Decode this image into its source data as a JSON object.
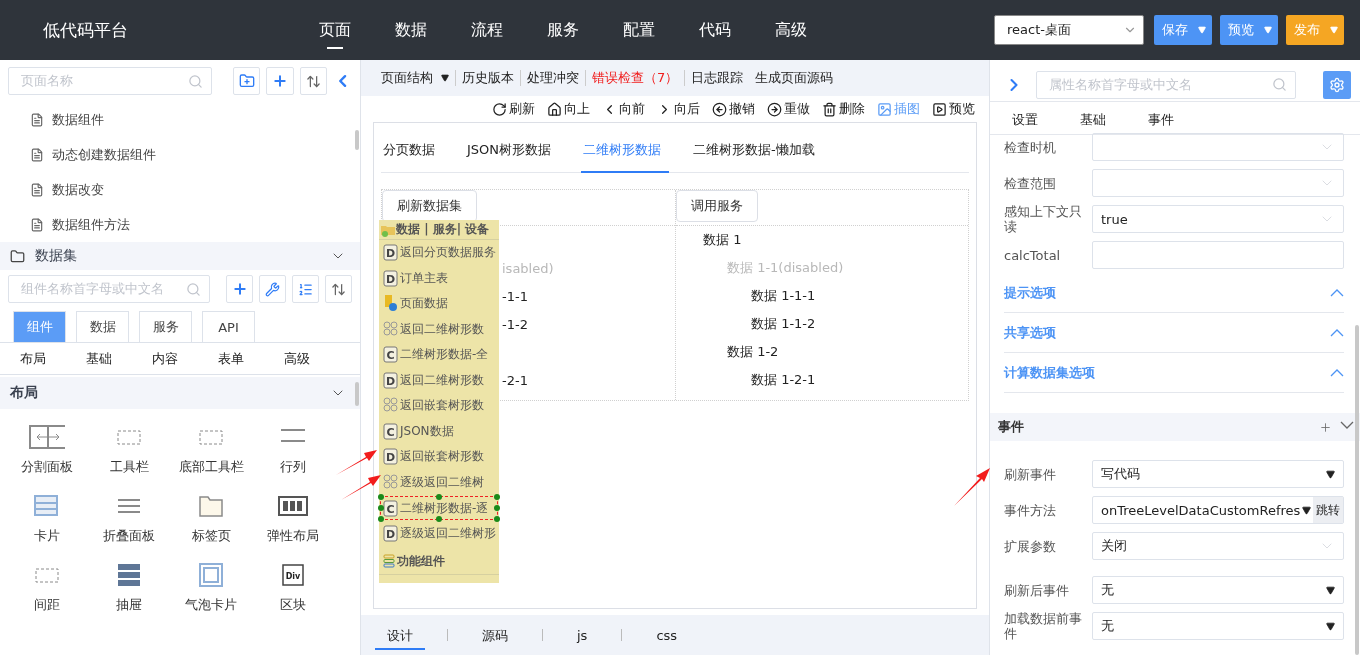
{
  "header": {
    "logo": "低代码平台",
    "nav": [
      {
        "label": "页面",
        "selected": true
      },
      {
        "label": "数据",
        "selected": false
      },
      {
        "label": "流程",
        "selected": false
      },
      {
        "label": "服务",
        "selected": false
      },
      {
        "label": "配置",
        "selected": false
      },
      {
        "label": "代码",
        "selected": false
      },
      {
        "label": "高级",
        "selected": false
      }
    ],
    "app_select": "react-桌面",
    "buttons": [
      {
        "label": "保存",
        "kind": "primary"
      },
      {
        "label": "预览",
        "kind": "primary"
      },
      {
        "label": "发布",
        "kind": "accent"
      }
    ]
  },
  "left_panel": {
    "page_search": {
      "placeholder": "页面名称"
    },
    "pages": [
      "数据组件",
      "动态创建数据组件",
      "数据改变",
      "数据组件方法"
    ],
    "dataset_section": "数据集",
    "component_search": {
      "placeholder": "组件名称首字母或中文名"
    },
    "tabs": [
      {
        "label": "组件",
        "selected": true
      },
      {
        "label": "数据",
        "selected": false
      },
      {
        "label": "服务",
        "selected": false
      },
      {
        "label": "API",
        "selected": false
      }
    ],
    "categories": [
      "布局",
      "基础",
      "内容",
      "表单",
      "高级"
    ],
    "layout_section": "布局",
    "components": [
      {
        "label": "分割面板"
      },
      {
        "label": "工具栏"
      },
      {
        "label": "底部工具栏"
      },
      {
        "label": "行列"
      },
      {
        "label": "卡片"
      },
      {
        "label": "折叠面板"
      },
      {
        "label": "标签页"
      },
      {
        "label": "弹性布局"
      },
      {
        "label": "间距"
      },
      {
        "label": "抽屉"
      },
      {
        "label": "气泡卡片"
      },
      {
        "label": "区块",
        "icon_text": "Div"
      }
    ]
  },
  "toolbar": {
    "menu": [
      {
        "label": "页面结构",
        "kind": "dropdown",
        "divider": true
      },
      {
        "label": "历史版本",
        "kind": "plain",
        "divider": true
      },
      {
        "label": "处理冲突",
        "kind": "plain",
        "divider": true
      },
      {
        "label": "错误检查（7）",
        "kind": "error",
        "divider": true
      },
      {
        "label": "日志跟踪",
        "kind": "plain",
        "divider": false
      },
      {
        "label": "生成页面源码",
        "kind": "plain",
        "divider": false
      }
    ],
    "actions": [
      {
        "label": "刷新",
        "highlighted": false
      },
      {
        "label": "向上",
        "highlighted": false
      },
      {
        "label": "向前",
        "highlighted": false
      },
      {
        "label": "向后",
        "highlighted": false
      },
      {
        "label": "撤销",
        "highlighted": false
      },
      {
        "label": "重做",
        "highlighted": false
      },
      {
        "label": "删除",
        "highlighted": false
      },
      {
        "label": "插图",
        "highlighted": true
      },
      {
        "label": "预览",
        "highlighted": false
      }
    ]
  },
  "canvas": {
    "tabs": [
      {
        "label": "分页数据",
        "selected": false
      },
      {
        "label": "JSON树形数据",
        "selected": false
      },
      {
        "label": "二维树形数据",
        "selected": true
      },
      {
        "label": "二维树形数据-懒加载",
        "selected": false
      }
    ],
    "buttons": [
      "刷新数据集",
      "调用服务"
    ],
    "left_tree": [
      {
        "kind": "covered"
      },
      {
        "kind": "text",
        "text": "isabled)",
        "disabled": true
      },
      {
        "kind": "text",
        "text": "-1-1",
        "disabled": false
      },
      {
        "kind": "text",
        "text": "-1-2",
        "disabled": false
      },
      {
        "kind": "covered"
      },
      {
        "kind": "text",
        "text": "-2-1",
        "disabled": false
      }
    ],
    "right_tree": [
      {
        "text": "数据 1",
        "disabled": false,
        "children": [
          {
            "text": "数据 1-1(disabled)",
            "disabled": true,
            "children": [
              {
                "text": "数据 1-1-1",
                "disabled": false
              },
              {
                "text": "数据 1-1-2",
                "disabled": false
              }
            ]
          },
          {
            "text": "数据 1-2",
            "disabled": false,
            "children": [
              {
                "text": "数据 1-2-1",
                "disabled": false
              }
            ]
          }
        ]
      }
    ]
  },
  "popup": {
    "title": "数据 | 服务| 设备",
    "items": [
      {
        "kind": "letter",
        "letter": "D",
        "text": "返回分页数据服务",
        "selected": false
      },
      {
        "kind": "letter",
        "letter": "D",
        "text": "订单主表",
        "selected": false
      },
      {
        "kind": "page",
        "text": "页面数据",
        "selected": false
      },
      {
        "kind": "clover",
        "text": "返回二维树形数",
        "selected": false
      },
      {
        "kind": "letter",
        "letter": "C",
        "text": "二维树形数据-全",
        "selected": false
      },
      {
        "kind": "letter",
        "letter": "D",
        "text": "返回二维树形数",
        "selected": false
      },
      {
        "kind": "clover",
        "text": "返回嵌套树形数",
        "selected": false
      },
      {
        "kind": "letter",
        "letter": "C",
        "text": "JSON数据",
        "selected": false
      },
      {
        "kind": "letter",
        "letter": "D",
        "text": "返回嵌套树形数",
        "selected": false
      },
      {
        "kind": "clover",
        "text": "逐级返回二维树",
        "selected": false
      },
      {
        "kind": "letter",
        "letter": "C",
        "text": "二维树形数据-逐",
        "selected": true
      },
      {
        "kind": "letter",
        "letter": "D",
        "text": "逐级返回二维树形",
        "selected": false
      }
    ],
    "footer": "功能组件"
  },
  "bottom_tabs": [
    {
      "label": "设计",
      "selected": true
    },
    {
      "label": "源码",
      "selected": false
    },
    {
      "label": "js",
      "selected": false
    },
    {
      "label": "css",
      "selected": false
    }
  ],
  "right_panel": {
    "search": {
      "placeholder": "属性名称首字母或中文名"
    },
    "tabs": [
      "设置",
      "基础",
      "事件"
    ],
    "fields": [
      {
        "label": "检查时机",
        "kind": "select"
      },
      {
        "label": "检查范围",
        "kind": "select"
      },
      {
        "label": "感知上下文只读",
        "kind": "select",
        "value": "true"
      },
      {
        "label": "calcTotal",
        "kind": "input"
      }
    ],
    "sections": [
      "提示选项",
      "共享选项",
      "计算数据集选项"
    ],
    "events_title": "事件",
    "event_fields": [
      {
        "label": "刷新事件",
        "kind": "dropdown",
        "value": "写代码"
      },
      {
        "label": "事件方法",
        "kind": "jump",
        "value": "onTreeLevelDataCustomRefres",
        "button": "跳转"
      },
      {
        "label": "扩展参数",
        "kind": "select",
        "value": "关闭"
      },
      {
        "label": "刷新后事件",
        "kind": "dropdown",
        "value": "无"
      },
      {
        "label": "加载数据前事件",
        "kind": "dropdown",
        "value": "无"
      }
    ]
  }
}
